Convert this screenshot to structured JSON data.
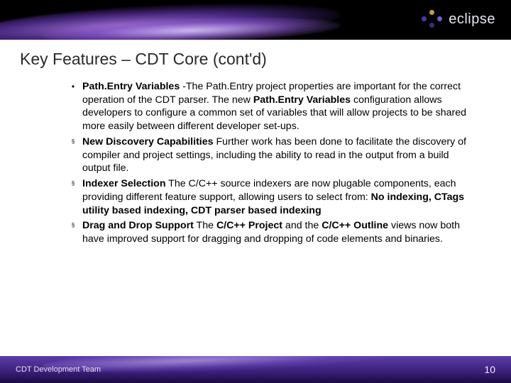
{
  "logo_text": "eclipse",
  "title": "Key Features – CDT Core (cont'd)",
  "bullets": [
    {
      "marker": "dot",
      "runs": [
        {
          "t": "Path.Entry Variables",
          "b": true
        },
        {
          "t": "  -The Path.Entry project properties are important for the correct operation of the CDT parser. The new ",
          "b": false
        },
        {
          "t": "Path.Entry Variables",
          "b": true
        },
        {
          "t": " configuration allows developers to configure a common set of variables that will allow projects to be shared more easily between different developer set-ups.",
          "b": false
        }
      ]
    },
    {
      "marker": "sq",
      "runs": [
        {
          "t": "New Discovery Capabilities",
          "b": true
        },
        {
          "t": " Further work has been done to facilitate the discovery of compiler and project settings, including the ability to read in the output from a build output file.",
          "b": false
        }
      ]
    },
    {
      "marker": "sq",
      "runs": [
        {
          "t": "Indexer Selection",
          "b": true
        },
        {
          "t": " The C/C++ source indexers are now plugable components, each providing different feature support, allowing users to select from: ",
          "b": false
        },
        {
          "t": "No indexing, CTags utility based indexing, CDT parser based indexing",
          "b": true
        }
      ]
    },
    {
      "marker": "sq",
      "runs": [
        {
          "t": "Drag and Drop Support",
          "b": true
        },
        {
          "t": " The ",
          "b": false
        },
        {
          "t": "C/C++ Project",
          "b": true
        },
        {
          "t": " and the ",
          "b": false
        },
        {
          "t": "C/C++ Outline",
          "b": true
        },
        {
          "t": " views now both have improved support for dragging and dropping of code elements and binaries.",
          "b": false
        }
      ]
    }
  ],
  "footer": {
    "team": "CDT Development Team",
    "page": "10"
  }
}
